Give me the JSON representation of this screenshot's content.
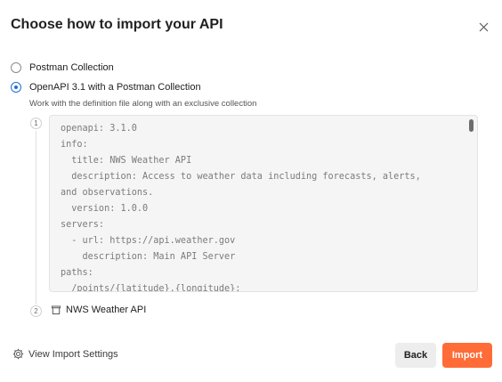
{
  "dialog": {
    "title": "Choose how to import your API"
  },
  "options": [
    {
      "label": "Postman Collection",
      "selected": false
    },
    {
      "label": "OpenAPI 3.1 with a Postman Collection",
      "selected": true,
      "description": "Work with the definition file along with an exclusive collection"
    }
  ],
  "steps": {
    "step1": "1",
    "step2": "2"
  },
  "definition": {
    "lines": [
      "openapi: 3.1.0",
      "info:",
      "  title: NWS Weather API",
      "  description: Access to weather data including forecasts, alerts,",
      "and observations.",
      "  version: 1.0.0",
      "servers:",
      "  - url: https://api.weather.gov",
      "    description: Main API Server",
      "paths:",
      "  /points/{latitude},{longitude}:"
    ]
  },
  "collection": {
    "name": "NWS Weather API",
    "icon": "collection-icon"
  },
  "footer": {
    "settings_label": "View Import Settings",
    "settings_icon": "gear-icon",
    "back_label": "Back",
    "import_label": "Import"
  },
  "colors": {
    "accent": "#ff6c37",
    "radio": "#1f6fd4"
  }
}
